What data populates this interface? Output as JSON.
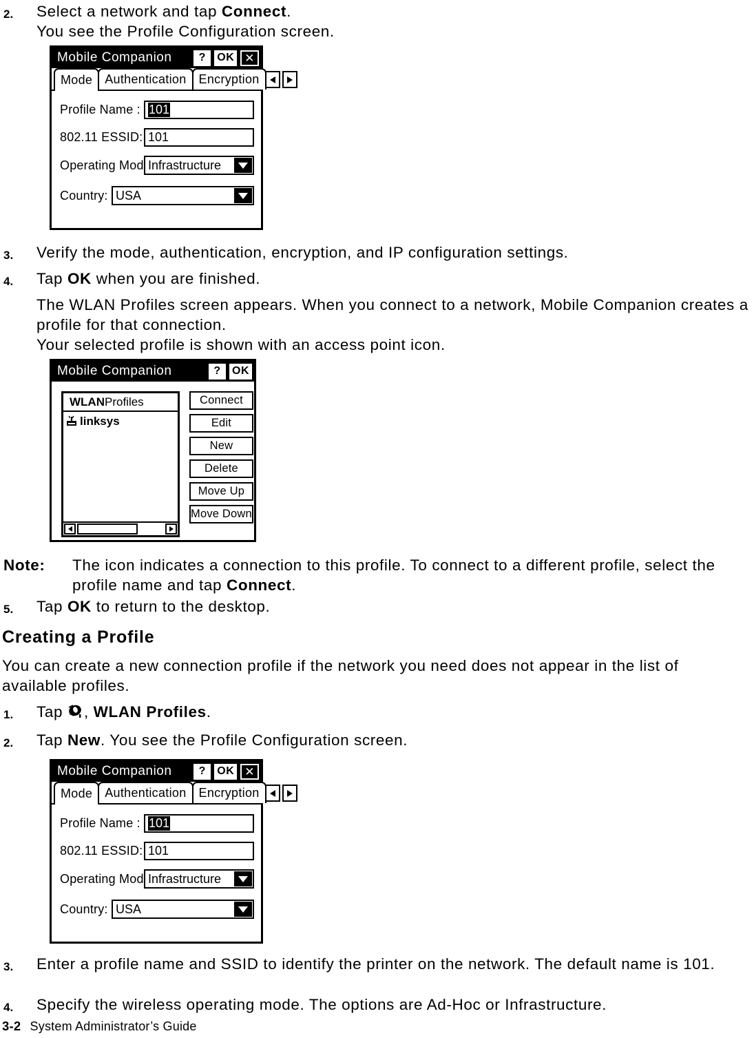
{
  "steps": {
    "s2a": {
      "num": "2.",
      "line1_pre": "Select a network and tap ",
      "line1_bold": "Connect",
      "line1_post": ".",
      "line2": "You see the Profile Configuration screen."
    },
    "s3": {
      "num": "3.",
      "text": "Verify the mode, authentication, encryption, and IP configuration settings."
    },
    "s4": {
      "num": "4.",
      "pre": "Tap ",
      "bold": "OK",
      "post": " when you are finished."
    },
    "s4_para_1": "The WLAN Profiles screen appears. When you connect to a network, Mobile Companion creates a profile for that connection.",
    "s4_para_2": "Your selected profile is shown with an access point icon.",
    "s5": {
      "num": "5.",
      "pre": "Tap ",
      "bold": "OK",
      "post": " to return to the desktop."
    },
    "c1": {
      "num": "1.",
      "pre": "Tap ",
      "icon": "wlan-signal-icon",
      "mid": ", ",
      "bold": "WLAN Profiles",
      "post": "."
    },
    "c2": {
      "num": "2.",
      "pre": "Tap ",
      "bold": "New",
      "post": ". You see the Profile Configuration screen."
    },
    "c3": {
      "num": "3.",
      "text": "Enter a profile name and SSID to identify the printer on the network.  The default name is 101."
    },
    "c4": {
      "num": "4.",
      "text": "Specify the wireless operating mode. The options are Ad-Hoc or Infrastructure."
    }
  },
  "note": {
    "label": "Note:",
    "pre": "The icon indicates a connection to this profile. To connect to a different profile, select the profile name and tap ",
    "bold": "Connect",
    "post": "."
  },
  "section": {
    "heading": "Creating a Profile",
    "intro": "You can create a new connection profile if the network you need does not appear in the list of available profiles."
  },
  "profile_dialog": {
    "title": "Mobile Companion",
    "titlebar_buttons": {
      "help": "?",
      "ok": "OK",
      "close": "✕"
    },
    "tabs": [
      {
        "label": "Mode",
        "active": true
      },
      {
        "label": "Authentication",
        "active": false
      },
      {
        "label": "Encryption",
        "active": false
      }
    ],
    "tab_scroll": {
      "prev": "left-arrow-icon",
      "next": "right-arrow-icon"
    },
    "fields": {
      "profile_name": {
        "label": "Profile Name :",
        "value": "101",
        "selected": true
      },
      "essid": {
        "label": "802.11 ESSID:",
        "value": "101"
      },
      "operating_mode": {
        "label": "Operating Mode:",
        "value": "Infrastructure",
        "options": [
          "Ad-Hoc",
          "Infrastructure"
        ]
      },
      "country": {
        "label": "Country:",
        "value": "USA",
        "options": [
          "USA"
        ]
      }
    }
  },
  "wlan_dialog": {
    "title": "Mobile Companion",
    "titlebar_buttons": {
      "help": "?",
      "ok": "OK"
    },
    "list_header": {
      "bold": "WLAN",
      "rest": " Profiles"
    },
    "list_items": [
      {
        "label": "linksys",
        "icon": "access-point-icon"
      }
    ],
    "buttons": [
      "Connect",
      "Edit",
      "New",
      "Delete",
      "Move Up",
      "Move Down"
    ]
  },
  "footer": {
    "page": "3-2",
    "title": "System Administrator’s Guide"
  },
  "colors": {
    "ink": "#000000",
    "paper": "#ffffff"
  }
}
